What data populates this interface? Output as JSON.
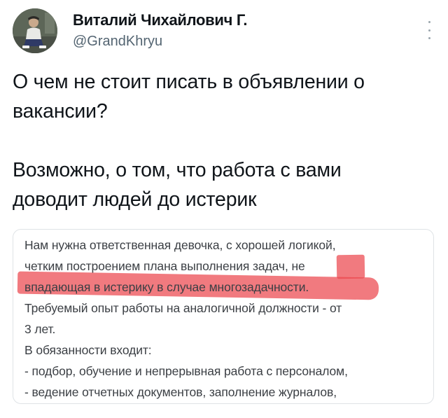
{
  "author": {
    "name": "Виталий Чихайлович Г.",
    "handle": "@GrandKhryu"
  },
  "tweet": {
    "text": "О чем не стоит писать в объявлении о\nвакансии?\n\nВозможно, о том, что работа с вами\nдоводит людей до истерик"
  },
  "job_ad": {
    "lines": [
      "Нам нужна ответственная девочка, с хорошей логикой,",
      "четким построением плана выполнения задач, не",
      "впадающая в истерику в случае многозадачности.",
      "Требуемый опыт работы на аналогичной должности - от",
      "3 лет.",
      "В обязанности входит:",
      "- подбор, обучение и непрерывная работа с персоналом,",
      "- ведение отчетных документов, заполнение журналов,"
    ],
    "highlight_color": "#ec464e"
  },
  "icons": {
    "more": "more-vertical-icon",
    "avatar": "user-avatar"
  }
}
